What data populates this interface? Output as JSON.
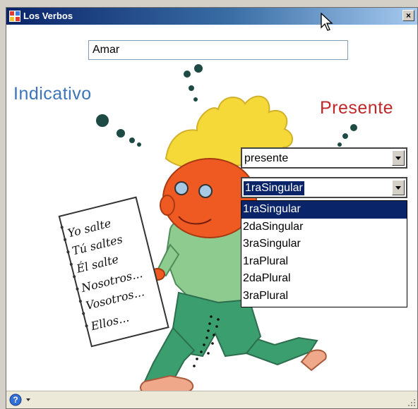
{
  "window": {
    "title": "Los Verbos",
    "close_label": "×"
  },
  "verb_input": {
    "value": "Amar"
  },
  "labels": {
    "mood": "Indicativo",
    "tense": "Presente"
  },
  "notebook_lines": [
    "Yo salte",
    "Tú saltes",
    "Él salte",
    "Nosotros...",
    "Vosotros...",
    "Ellos..."
  ],
  "tense_combo": {
    "selected": "presente"
  },
  "person_combo": {
    "selected": "1raSingular",
    "options": [
      "1raSingular",
      "2daSingular",
      "3raSingular",
      "1raPlural",
      "2daPlural",
      "3raPlural"
    ]
  },
  "colors": {
    "title_gradient_start": "#0a246a",
    "mood_label": "#3e74b8",
    "tense_label": "#c0282a",
    "selection": "#0a246a",
    "hair": "#f4d938",
    "face": "#ee5a22",
    "shirt": "#8ecb8e",
    "pants": "#3a9e6e"
  },
  "icons": {
    "app": "app-icon",
    "close": "close-icon",
    "dropdown": "chevron-down-icon",
    "help": "help-icon",
    "grip": "resize-grip-icon"
  }
}
